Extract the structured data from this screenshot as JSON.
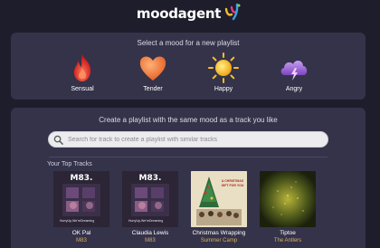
{
  "header": {
    "logo_text": "moodagent",
    "logo_icon": "moodagent-logo-icon"
  },
  "moods": {
    "heading": "Select a mood for a new playlist",
    "items": [
      {
        "label": "Sensual",
        "icon": "flame-icon",
        "color": "#e2332b"
      },
      {
        "label": "Tender",
        "icon": "heart-icon",
        "color": "#f07a38"
      },
      {
        "label": "Happy",
        "icon": "sun-icon",
        "color": "#f5c21e"
      },
      {
        "label": "Angry",
        "icon": "storm-cloud-icon",
        "color": "#a56dd8"
      }
    ]
  },
  "track_search": {
    "heading": "Create a playlist with the same mood as a track you like",
    "placeholder": "Search for track to create a playlist with similar tracks",
    "search_icon": "search-icon"
  },
  "top_tracks": {
    "label": "Your Top Tracks",
    "items": [
      {
        "title": "OK Pal",
        "artist": "M83",
        "cover_text": "M83.",
        "cover_caption": "HurryUp,We'reDreaming"
      },
      {
        "title": "Claudia Lewis",
        "artist": "M83",
        "cover_text": "M83.",
        "cover_caption": "HurryUp,We'reDreaming"
      },
      {
        "title": "Christmas Wrapping",
        "artist": "Summer Camp",
        "cover_text": "A CHRISTMAS GIFT FOR YOU"
      },
      {
        "title": "Tiptoe",
        "artist": "The Antlers"
      }
    ]
  },
  "colors": {
    "background": "#1e1d2b",
    "panel": "#35334a",
    "artist_text": "#d9b15c"
  }
}
